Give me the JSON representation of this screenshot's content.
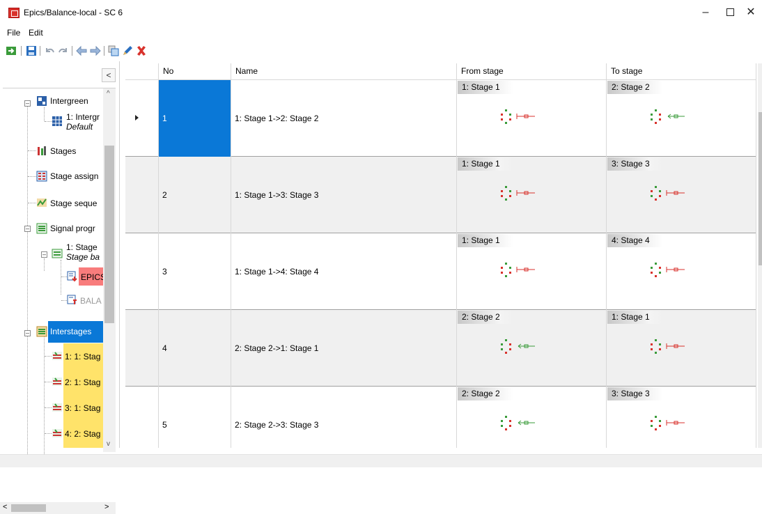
{
  "window": {
    "title": "Epics/Balance-local - SC 6",
    "controls": {
      "minimize": "–",
      "close": "✕"
    }
  },
  "menu": {
    "items": [
      "File",
      "Edit"
    ]
  },
  "toolbar": {
    "icons": [
      "open-icon",
      "save-icon",
      "undo-icon",
      "redo-icon",
      "back-icon",
      "forward-icon",
      "copy-icon",
      "edit-icon",
      "delete-icon"
    ]
  },
  "tree": {
    "collapse_label": "<",
    "nodes": [
      {
        "label": "Intergreen",
        "italic": ""
      },
      {
        "label": "1: Intergr",
        "italic": "Default"
      },
      {
        "label": "Stages",
        "italic": ""
      },
      {
        "label": "Stage assign",
        "italic": ""
      },
      {
        "label": "Stage seque",
        "italic": ""
      },
      {
        "label": "Signal progr",
        "italic": ""
      },
      {
        "label": "1: Stage",
        "italic": "Stage ba"
      },
      {
        "label": "EPICS",
        "italic": ""
      },
      {
        "label": "BALA",
        "italic": ""
      },
      {
        "label": "Interstages",
        "italic": ""
      },
      {
        "label": "1: 1: Stag",
        "italic": ""
      },
      {
        "label": "2: 1: Stag",
        "italic": ""
      },
      {
        "label": "3: 1: Stag",
        "italic": ""
      },
      {
        "label": "4: 2: Stag",
        "italic": ""
      }
    ],
    "colors": {
      "epics_bg": "#f87c7c",
      "interstages_bg": "#0a78d7",
      "yellow": "#ffe36a"
    }
  },
  "grid": {
    "columns": [
      "No",
      "Name",
      "From stage",
      "To stage"
    ],
    "rows": [
      {
        "no": "1",
        "name": "1: Stage 1->2: Stage 2",
        "from": "1: Stage 1",
        "to": "2: Stage 2"
      },
      {
        "no": "2",
        "name": "1: Stage 1->3: Stage 3",
        "from": "1: Stage 1",
        "to": "3: Stage 3"
      },
      {
        "no": "3",
        "name": "1: Stage 1->4: Stage 4",
        "from": "1: Stage 1",
        "to": "4: Stage 4"
      },
      {
        "no": "4",
        "name": "2: Stage 2->1: Stage 1",
        "from": "2: Stage 2",
        "to": "1: Stage 1"
      },
      {
        "no": "5",
        "name": "2: Stage 2->3: Stage 3",
        "from": "2: Stage 2",
        "to": "3: Stage 3"
      }
    ]
  }
}
